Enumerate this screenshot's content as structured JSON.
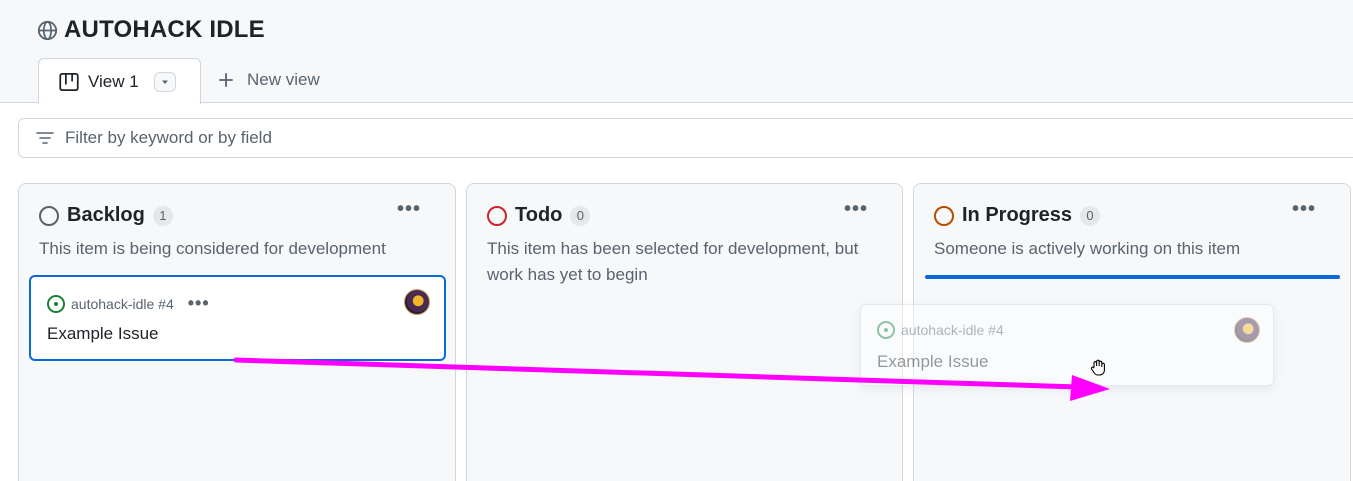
{
  "project": {
    "title": "AUTOHACK IDLE",
    "icon": "globe-icon"
  },
  "tabs": {
    "active": {
      "label": "View 1",
      "icon": "board-icon"
    },
    "new_view": {
      "label": "New view",
      "icon": "plus-icon"
    }
  },
  "filter": {
    "placeholder": "Filter by keyword or by field",
    "icon": "filter-icon"
  },
  "columns": [
    {
      "name": "Backlog",
      "count": "1",
      "description": "This item is being considered for development",
      "color": "#59636e"
    },
    {
      "name": "Todo",
      "count": "0",
      "description": "This item has been selected for development, but work has yet to begin",
      "color": "#cf222e"
    },
    {
      "name": "In Progress",
      "count": "0",
      "description": "Someone is actively working on this item",
      "color": "#bc4c00"
    }
  ],
  "cards": [
    {
      "repo_ref": "autohack-idle #4",
      "title": "Example Issue"
    }
  ],
  "drag_ghost": {
    "repo_ref": "autohack-idle #4",
    "title": "Example Issue"
  },
  "colors": {
    "accent": "#0969da",
    "annotation_arrow": "#ff00ff",
    "issue_open": "#1a7f37"
  }
}
